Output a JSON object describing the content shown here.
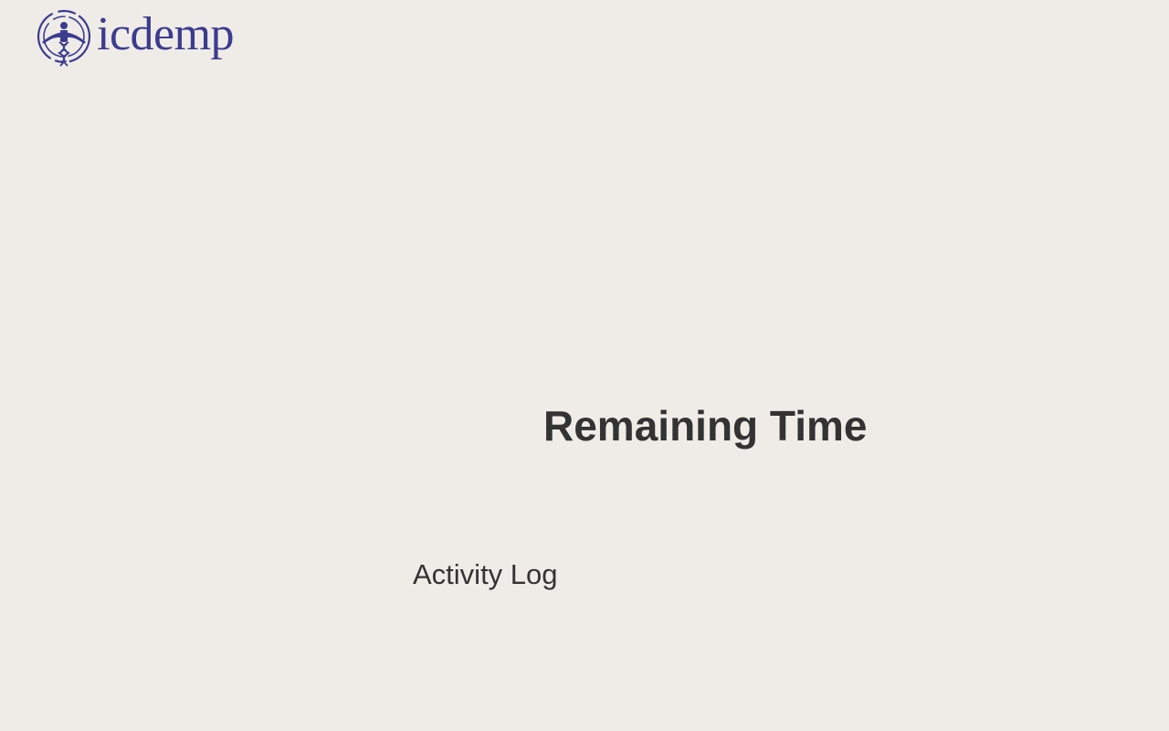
{
  "header": {
    "logo": {
      "text": "icdemp",
      "icon": "dna-figure-icon",
      "color": "#3b3c8f"
    }
  },
  "main": {
    "remaining_time_heading": "Remaining Time",
    "activity_log_heading": "Activity Log"
  },
  "colors": {
    "background": "#efece7",
    "text": "#333333",
    "brand": "#3b3c8f"
  }
}
